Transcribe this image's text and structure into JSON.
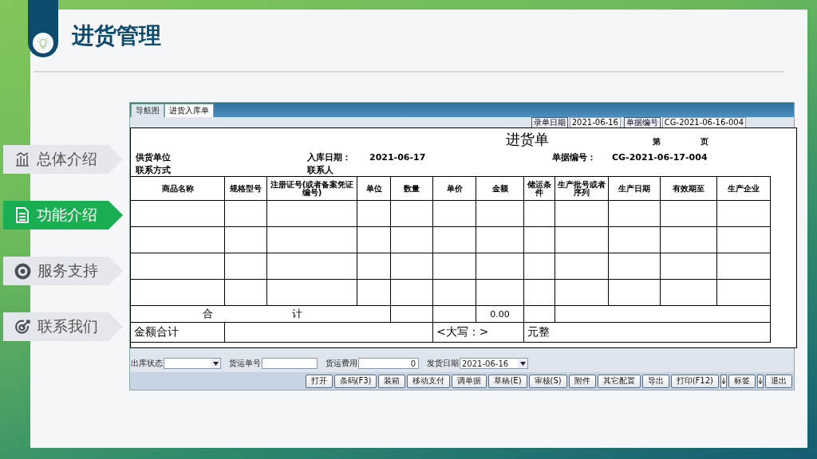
{
  "slide": {
    "title": "进货管理"
  },
  "nav": [
    {
      "label": "总体介绍",
      "kind": "chart",
      "selected": false
    },
    {
      "label": "功能介绍",
      "kind": "document",
      "selected": true
    },
    {
      "label": "服务支持",
      "kind": "target",
      "selected": false
    },
    {
      "label": "联系我们",
      "kind": "goal",
      "selected": false
    }
  ],
  "app": {
    "tabs": [
      {
        "label": "导航图",
        "selected": false
      },
      {
        "label": "进货入库单",
        "selected": true
      }
    ],
    "header_fields": [
      {
        "label": "录单日期",
        "value": "2021-06-16"
      },
      {
        "label": "单据编号",
        "value": "CG-2021-06-16-004"
      }
    ],
    "print_preview": {
      "title": "进货单",
      "page_label_parts": [
        "第",
        "页"
      ],
      "info_rows": [
        [
          {
            "label": "供货单位"
          },
          {
            "label": "入库日期：",
            "value": "2021-06-17"
          },
          {
            "label": "单据编号：",
            "value": "CG-2021-06-17-004"
          }
        ],
        [
          {
            "label": "联系方式"
          },
          {
            "label": "联系人"
          }
        ]
      ],
      "columns": [
        "商品名称",
        "规格型号",
        "注册证号(或者备案凭证编号)",
        "单位",
        "数量",
        "单价",
        "金额",
        "储运条件",
        "生产批号或者序列",
        "生产日期",
        "有效期至",
        "生产企业"
      ],
      "rows": [
        {
          "kind": "blank"
        },
        {
          "kind": "blank"
        },
        {
          "kind": "blank"
        },
        {
          "kind": "blank"
        }
      ],
      "total_label_parts": [
        "合",
        "计"
      ],
      "amount_total": "0.00",
      "summary": {
        "label": "金额合计",
        "uppercase_label": "<大写：>",
        "unit": "元整"
      }
    },
    "fields": [
      {
        "label": "出库状态",
        "kind": "select"
      },
      {
        "label": "货运单号",
        "kind": "input"
      },
      {
        "label": "货运费用",
        "kind": "input",
        "value": "0"
      },
      {
        "label": "发货日期",
        "kind": "select",
        "value": "2021-06-16"
      }
    ],
    "buttons": [
      {
        "label": "打开",
        "kind": "button"
      },
      {
        "label": "条码(F3)",
        "kind": "button"
      },
      {
        "label": "装箱",
        "kind": "button"
      },
      {
        "label": "移动支付",
        "kind": "button"
      },
      {
        "label": "调单据",
        "kind": "button"
      },
      {
        "label": "草稿(E)",
        "kind": "button"
      },
      {
        "label": "审核(S)",
        "kind": "button"
      },
      {
        "label": "附件",
        "kind": "button"
      },
      {
        "label": "其它配置",
        "kind": "button"
      },
      {
        "label": "导出",
        "kind": "button"
      },
      {
        "label": "打印(F12)",
        "kind": "split"
      },
      {
        "label": "标签",
        "kind": "split"
      },
      {
        "label": "退出",
        "kind": "button"
      }
    ]
  }
}
